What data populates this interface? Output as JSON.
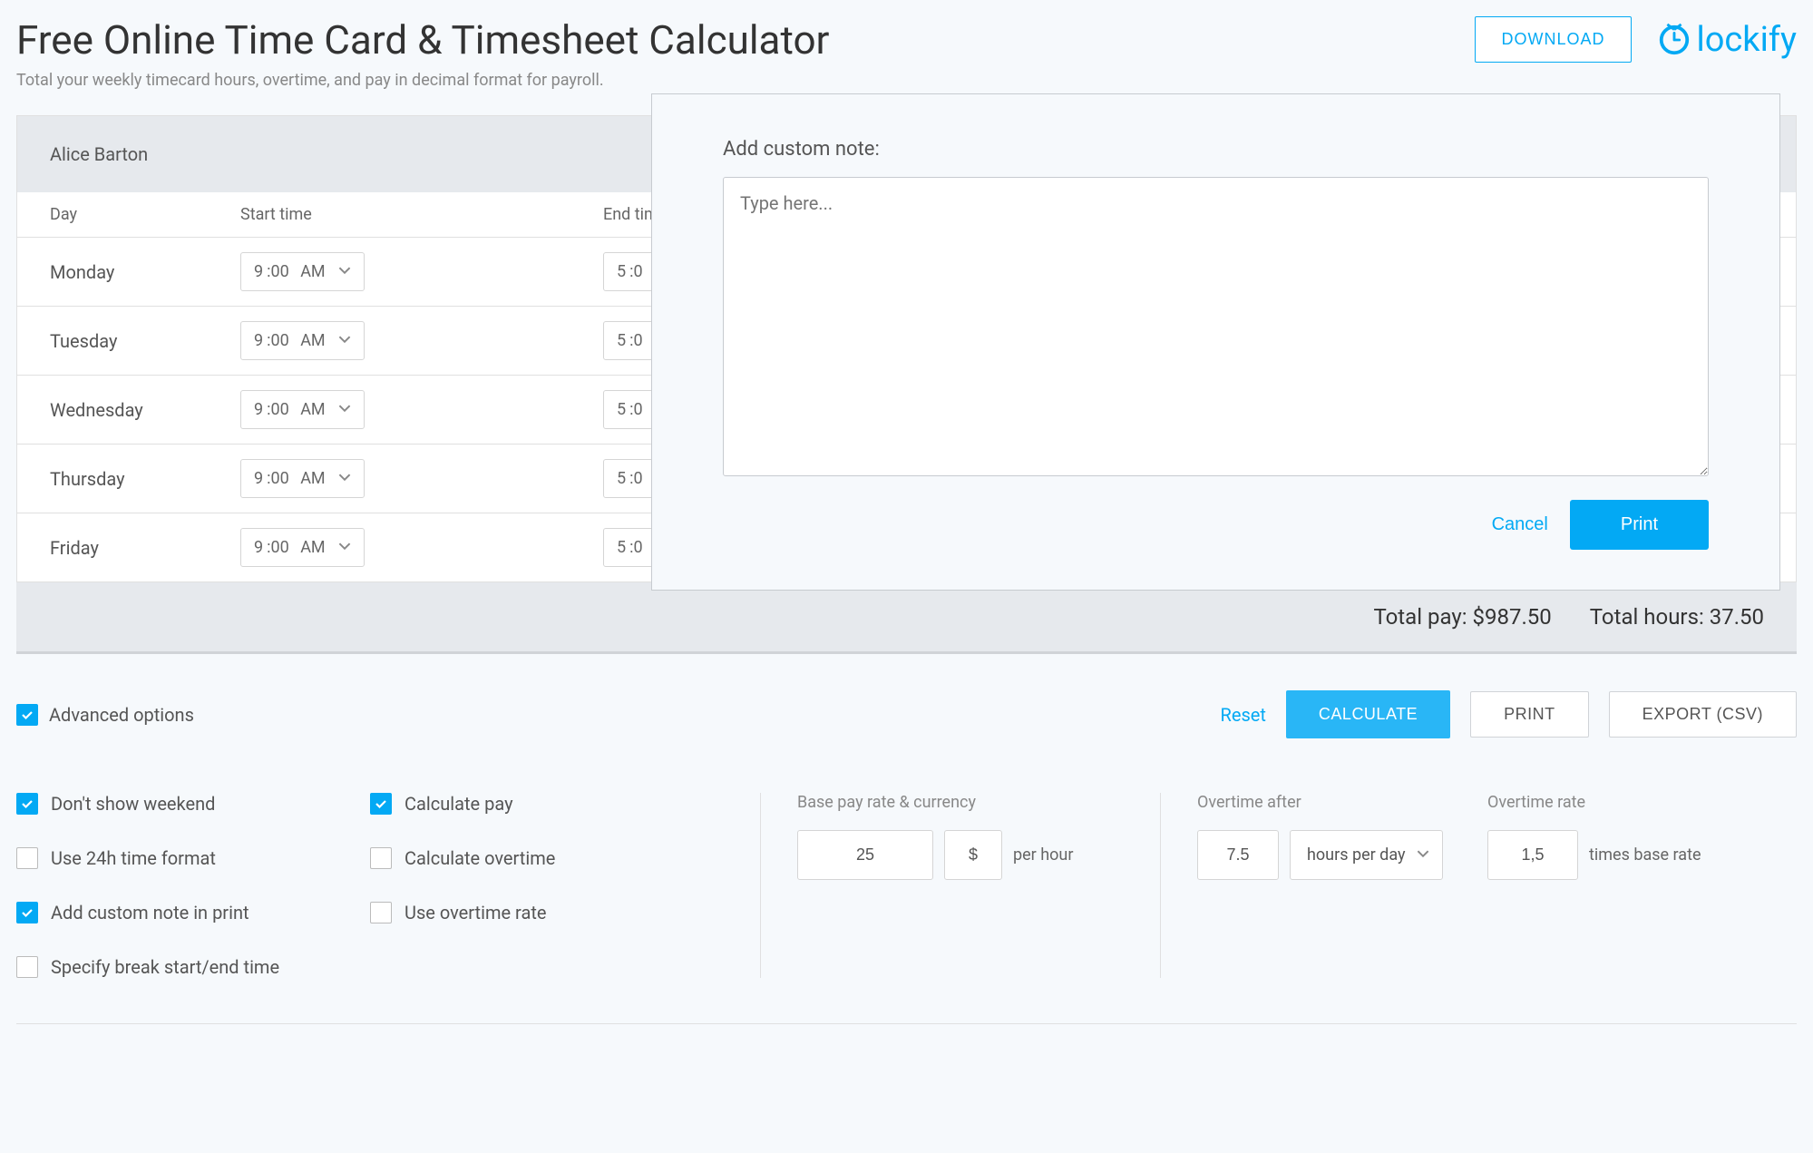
{
  "header": {
    "title": "Free Online Time Card & Timesheet Calculator",
    "subtitle": "Total your weekly timecard hours, overtime, and pay in decimal format for payroll.",
    "download": "DOWNLOAD",
    "brand": "lockify"
  },
  "employee": "Alice Barton",
  "columns": {
    "day": "Day",
    "start": "Start time",
    "end": "End time"
  },
  "days": [
    {
      "name": "Monday",
      "start_h": "9",
      "start_m": ":00",
      "start_ap": "AM",
      "end_h": "5",
      "end_m": ":0"
    },
    {
      "name": "Tuesday",
      "start_h": "9",
      "start_m": ":00",
      "start_ap": "AM",
      "end_h": "5",
      "end_m": ":0"
    },
    {
      "name": "Wednesday",
      "start_h": "9",
      "start_m": ":00",
      "start_ap": "AM",
      "end_h": "5",
      "end_m": ":0"
    },
    {
      "name": "Thursday",
      "start_h": "9",
      "start_m": ":00",
      "start_ap": "AM",
      "end_h": "5",
      "end_m": ":0"
    },
    {
      "name": "Friday",
      "start_h": "9",
      "start_m": ":00",
      "start_ap": "AM",
      "end_h": "5",
      "end_m": ":0"
    }
  ],
  "totals": {
    "pay_label": "Total pay:",
    "pay_value": "$987.50",
    "hours_label": "Total hours:",
    "hours_value": "37.50"
  },
  "modal": {
    "title": "Add custom note:",
    "placeholder": "Type here...",
    "cancel": "Cancel",
    "print": "Print"
  },
  "controls": {
    "advanced": "Advanced options",
    "reset": "Reset",
    "calculate": "CALCULATE",
    "print": "PRINT",
    "export": "EXPORT (CSV)"
  },
  "options": {
    "no_weekend": "Don't show weekend",
    "use_24h": "Use 24h time format",
    "add_note": "Add custom note in print",
    "spec_break": "Specify break start/end time",
    "calc_pay": "Calculate pay",
    "calc_ot": "Calculate overtime",
    "use_ot_rate": "Use overtime rate"
  },
  "pay": {
    "label": "Base pay rate & currency",
    "rate": "25",
    "currency": "$",
    "per": "per hour"
  },
  "overtime": {
    "after_label": "Overtime after",
    "after_value": "7.5",
    "after_unit": "hours per day",
    "rate_label": "Overtime rate",
    "rate_value": "1,5",
    "rate_unit": "times base rate"
  }
}
